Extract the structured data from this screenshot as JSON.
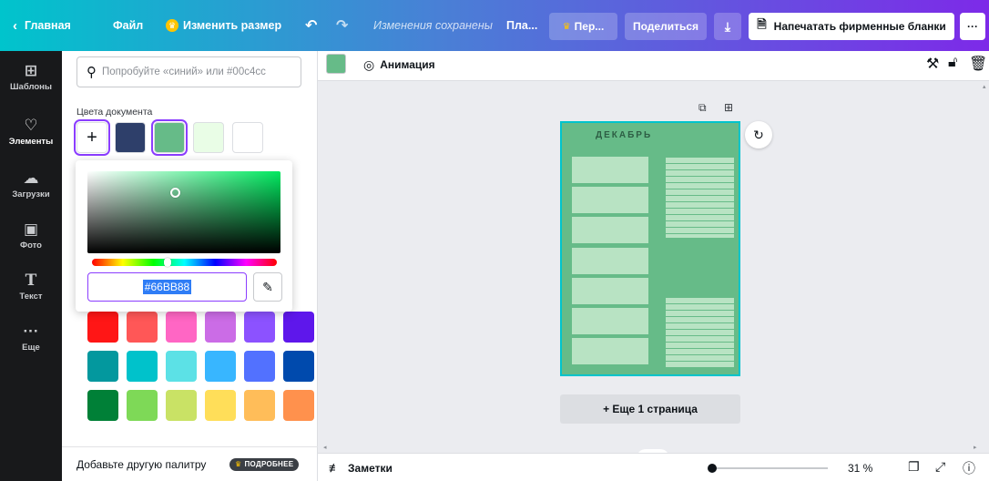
{
  "topbar": {
    "back_label": "Главная",
    "file_label": "Файл",
    "resize_label": "Изменить размер",
    "status_text": "Изменения сохранены",
    "plan_label": "Пла...",
    "pro_label": "Пер...",
    "share_label": "Поделиться",
    "print_label": "Напечатать фирменные бланки",
    "more_label": "···"
  },
  "nav": {
    "items": [
      {
        "label": "Шаблоны",
        "icon": "layout-icon"
      },
      {
        "label": "Элементы",
        "icon": "shapes-icon"
      },
      {
        "label": "Загрузки",
        "icon": "cloud-upload-icon"
      },
      {
        "label": "Фото",
        "icon": "image-icon"
      },
      {
        "label": "Текст",
        "icon": "text-icon"
      },
      {
        "label": "Еще",
        "icon": "more-dots-icon"
      }
    ]
  },
  "panel": {
    "search_placeholder": "Попробуйте «синий» или #00c4cc",
    "doc_colors_label": "Цвета документа",
    "doc_colors": [
      "#2e3f6a",
      "#66bb88",
      "#e9fde6",
      "#ffffff"
    ],
    "palette": [
      [
        "#ff1616",
        "#ff5757",
        "#ff66c4",
        "#cb6ce6",
        "#8c52ff",
        "#5e17eb"
      ],
      [
        "#03989e",
        "#00c2cb",
        "#5ce1e6",
        "#38b6ff",
        "#5271ff",
        "#004aad"
      ],
      [
        "#008037",
        "#7ed957",
        "#c9e265",
        "#ffde59",
        "#ffbd59",
        "#ff914d"
      ]
    ],
    "footer_text": "Добавьте другую палитру",
    "footer_badge": "ПОДРОБНЕЕ"
  },
  "picker": {
    "hex_value": "#66BB88"
  },
  "toolbar": {
    "current_color": "#66bb88",
    "animation_label": "Анимация"
  },
  "page": {
    "title": "ДЕКАБРЬ",
    "add_page_label": "+ Еще 1 страница"
  },
  "bottombar": {
    "notes_label": "Заметки",
    "zoom_label": "31 %",
    "zoom_level_percent": 31
  }
}
